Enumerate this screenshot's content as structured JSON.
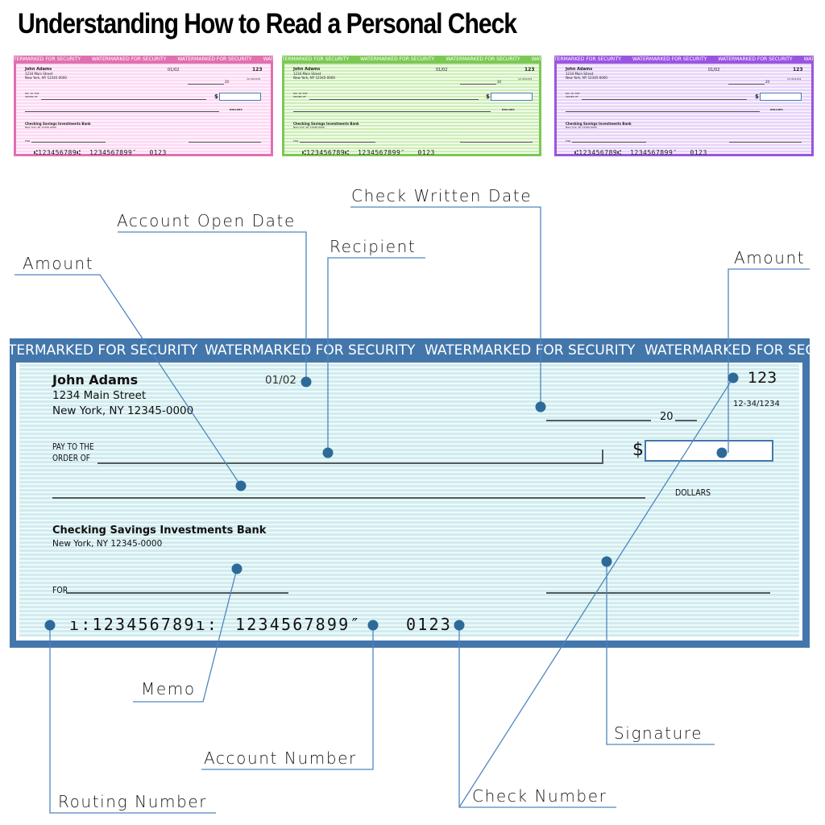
{
  "title": "Understanding How to Read a Personal Check",
  "colors": {
    "accent": "#4377ab",
    "dot": "#2e6a99",
    "leader": "#4f86bf",
    "stripe_light": "#ecfbfc",
    "stripe_dark": "#d3ebee",
    "mini_pink": "#e070b0",
    "mini_green": "#7cc855",
    "mini_purple": "#9a55e0"
  },
  "watermark": "WATERMARKED FOR SECURITY",
  "watermark_first_clip": "TERMARKED FOR SECURITY",
  "watermark_last_clip": "WATERMARKED FOR SECU",
  "mini_checks": [
    {
      "variant": "pink"
    },
    {
      "variant": "green"
    },
    {
      "variant": "purple"
    }
  ],
  "check": {
    "owner_name": "John Adams",
    "owner_street": "1234 Main Street",
    "owner_city": "New York, NY 12345-0000",
    "account_open_date": "01/02",
    "check_number": "123",
    "fraction_code": "12-34/1234",
    "year_prefix": "20",
    "pay_to_line1": "PAY TO THE",
    "pay_to_line2": "ORDER OF",
    "dollar_sign": "$",
    "dollars_word": "DOLLARS",
    "bank_name": "Checking Savings Investments Bank",
    "bank_city": "New York, NY 12345-0000",
    "memo_label": "FOR",
    "micr_routing": "⑆123456789⑆",
    "micr_routing_display": "ı:123456789ı:",
    "micr_account": "1234567899″",
    "micr_check_number": "0123"
  },
  "annotations": {
    "account_open_date": "Account Open Date",
    "check_written_date": "Check Written Date",
    "recipient": "Recipient",
    "amount_words": "Amount",
    "amount_numeric": "Amount",
    "memo": "Memo",
    "account_number": "Account Number",
    "routing_number": "Routing Number",
    "signature": "Signature",
    "check_number": "Check Number"
  }
}
